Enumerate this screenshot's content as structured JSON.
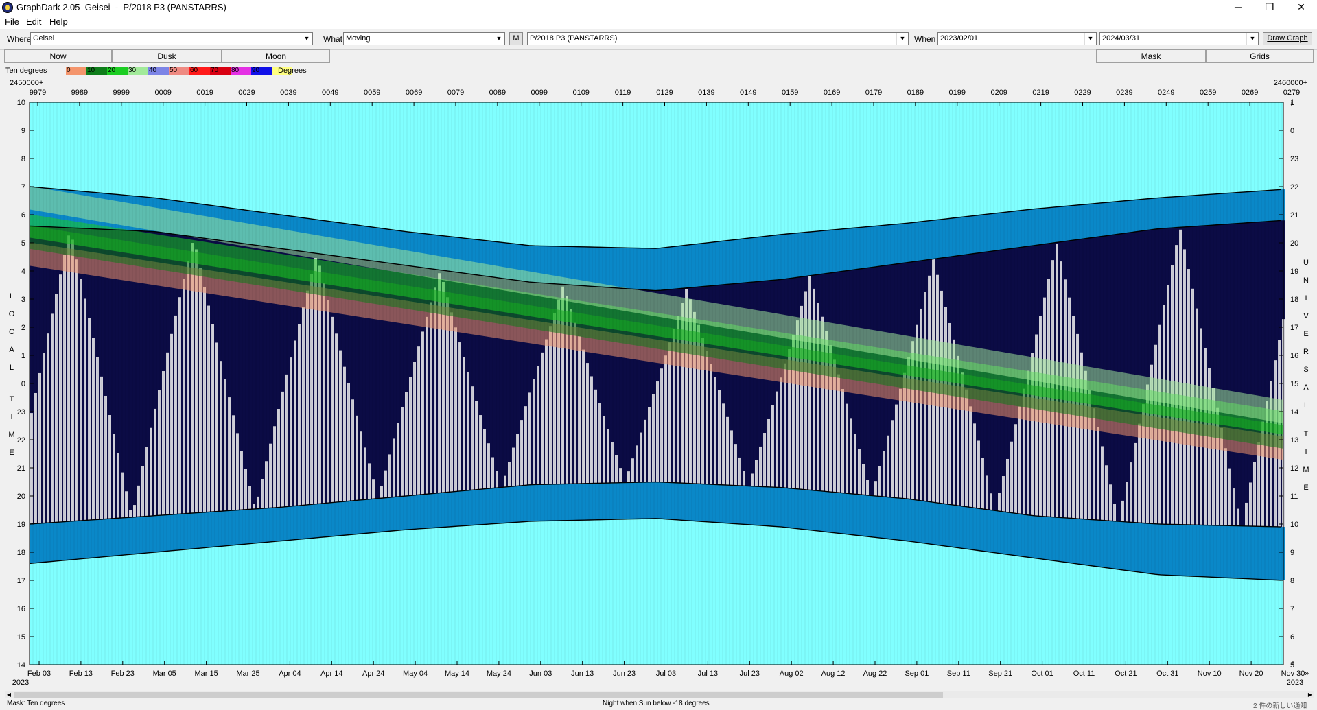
{
  "window": {
    "title": "GraphDark 2.05  Geisei  -  P/2018 P3 (PANSTARRS)",
    "minimize_glyph": "─",
    "maximize_glyph": "❐",
    "close_glyph": "✕"
  },
  "menu": {
    "items": [
      "File",
      "Edit",
      "Help"
    ]
  },
  "toolbar": {
    "where_label": "Where",
    "where_value": "Geisei",
    "what_label": "What",
    "what_value": "Moving",
    "m_button": "M",
    "object_value": "P/2018 P3 (PANSTARRS)",
    "when_label": "When",
    "start_date": "2023/02/01",
    "end_date": "2024/03/31",
    "draw_button": "Draw Graph"
  },
  "tabs": {
    "now": "Now",
    "dusk": "Dusk",
    "moon": "Moon",
    "mask": "Mask",
    "grids": "Grids"
  },
  "legend": {
    "title": "Ten degrees",
    "units": "Degrees",
    "items": [
      {
        "label": "0",
        "color": "#f4956c"
      },
      {
        "label": "10",
        "color": "#0e7d1a"
      },
      {
        "label": "20",
        "color": "#1bcd22"
      },
      {
        "label": "30",
        "color": "#a2ea9a"
      },
      {
        "label": "40",
        "color": "#7c84e6"
      },
      {
        "label": "50",
        "color": "#ef8a82"
      },
      {
        "label": "60",
        "color": "#ff1a1a"
      },
      {
        "label": "70",
        "color": "#d80012"
      },
      {
        "label": "80",
        "color": "#e430e4"
      },
      {
        "label": "90",
        "color": "#1010e8"
      },
      {
        "label": "",
        "color": "#ffff80"
      }
    ]
  },
  "chart_data": {
    "type": "heatmap",
    "xlabel": "",
    "ylabel_left": "LOCAL TIME",
    "ylabel_right": "UNIVERSAL TIME",
    "jd_left_prefix": "2450000+",
    "jd_right_prefix": "2460000+",
    "jd_ticks": [
      "9979",
      "9989",
      "9999",
      "0009",
      "0019",
      "0029",
      "0039",
      "0049",
      "0059",
      "0069",
      "0079",
      "0089",
      "0099",
      "0109",
      "0119",
      "0129",
      "0139",
      "0149",
      "0159",
      "0169",
      "0179",
      "0189",
      "0199",
      "0209",
      "0219",
      "0229",
      "0239",
      "0249",
      "0259",
      "0269",
      "0279"
    ],
    "date_ticks": [
      "Feb 03",
      "Feb 13",
      "Feb 23",
      "Mar 05",
      "Mar 15",
      "Mar 25",
      "Apr 04",
      "Apr 14",
      "Apr 24",
      "May 04",
      "May 14",
      "May 24",
      "Jun 03",
      "Jun 13",
      "Jun 23",
      "Jul 03",
      "Jul 13",
      "Jul 23",
      "Aug 02",
      "Aug 12",
      "Aug 22",
      "Sep 01",
      "Sep 11",
      "Sep 21",
      "Oct 01",
      "Oct 11",
      "Oct 21",
      "Oct 31",
      "Nov 10",
      "Nov 20",
      "Nov 30"
    ],
    "year_left": "2023",
    "year_right": "2023",
    "more_marker": "»",
    "local_time_ticks": [
      "10",
      "9",
      "8",
      "7",
      "6",
      "5",
      "4",
      "3",
      "2",
      "1",
      "0",
      "23",
      "22",
      "21",
      "20",
      "19",
      "18",
      "17",
      "16",
      "15",
      "14"
    ],
    "ut_ticks": [
      "1",
      "0",
      "23",
      "22",
      "21",
      "20",
      "19",
      "18",
      "17",
      "16",
      "15",
      "14",
      "13",
      "12",
      "11",
      "10",
      "9",
      "8",
      "7",
      "6",
      "5"
    ],
    "y_range_local_hours": [
      14,
      34
    ],
    "dark_night": {
      "dates": [
        "Feb 03",
        "Mar 05",
        "Apr 04",
        "May 04",
        "Jun 03",
        "Jul 03",
        "Aug 02",
        "Sep 01",
        "Oct 01",
        "Oct 31",
        "Nov 30"
      ],
      "dusk_local": [
        19.0,
        19.3,
        19.6,
        20.0,
        20.4,
        20.5,
        20.3,
        19.9,
        19.3,
        19.0,
        18.9
      ],
      "dawn_local": [
        29.6,
        29.4,
        28.8,
        28.2,
        27.6,
        27.3,
        27.7,
        28.3,
        28.9,
        29.5,
        29.8
      ]
    },
    "twilight": {
      "sunset_local": [
        17.6,
        18.0,
        18.4,
        18.8,
        19.1,
        19.2,
        18.9,
        18.4,
        17.8,
        17.2,
        17.0
      ],
      "sunrise_local": [
        31.0,
        30.6,
        30.0,
        29.4,
        28.9,
        28.8,
        29.3,
        29.7,
        30.2,
        30.6,
        30.9
      ]
    },
    "object_bands": [
      {
        "name": "0",
        "color": "#f4956c",
        "start_local": 28.6,
        "end_local": 21.7
      },
      {
        "name": "10",
        "color": "#0e7d1a",
        "start_local": 29.2,
        "end_local": 22.1
      },
      {
        "name": "20",
        "color": "#1bcd22",
        "start_local": 29.6,
        "end_local": 22.6
      },
      {
        "name": "30",
        "color": "#a2ea9a",
        "start_local": 30.6,
        "end_local": 23.0
      }
    ],
    "colors": {
      "background": "#80ffff",
      "night": "#0b0b45",
      "twilight": "#0a88c8",
      "moonlit": "#cfcfd8"
    },
    "grid": false
  },
  "status": {
    "mask": "Mask:  Ten degrees",
    "night": "Night when Sun below -18 degrees",
    "notice": "2 件の新しい通知"
  }
}
